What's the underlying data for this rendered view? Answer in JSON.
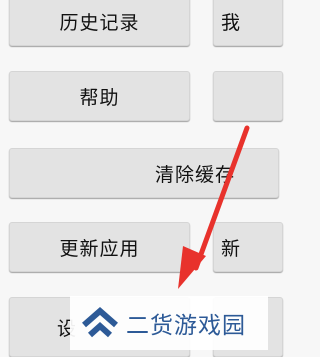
{
  "buttons": {
    "history": "历史记录",
    "history_right_partial": "我",
    "help": "帮助",
    "help_right_partial": "",
    "clear_cache": "清除缓存",
    "update_app": "更新应用",
    "update_right_partial": "新",
    "settings_partial": "设",
    "settings_right_partial": ""
  },
  "annotation": {
    "arrow_color": "#e8322c"
  },
  "watermark": {
    "text": "二货游戏园",
    "color": "#2d5a97"
  }
}
